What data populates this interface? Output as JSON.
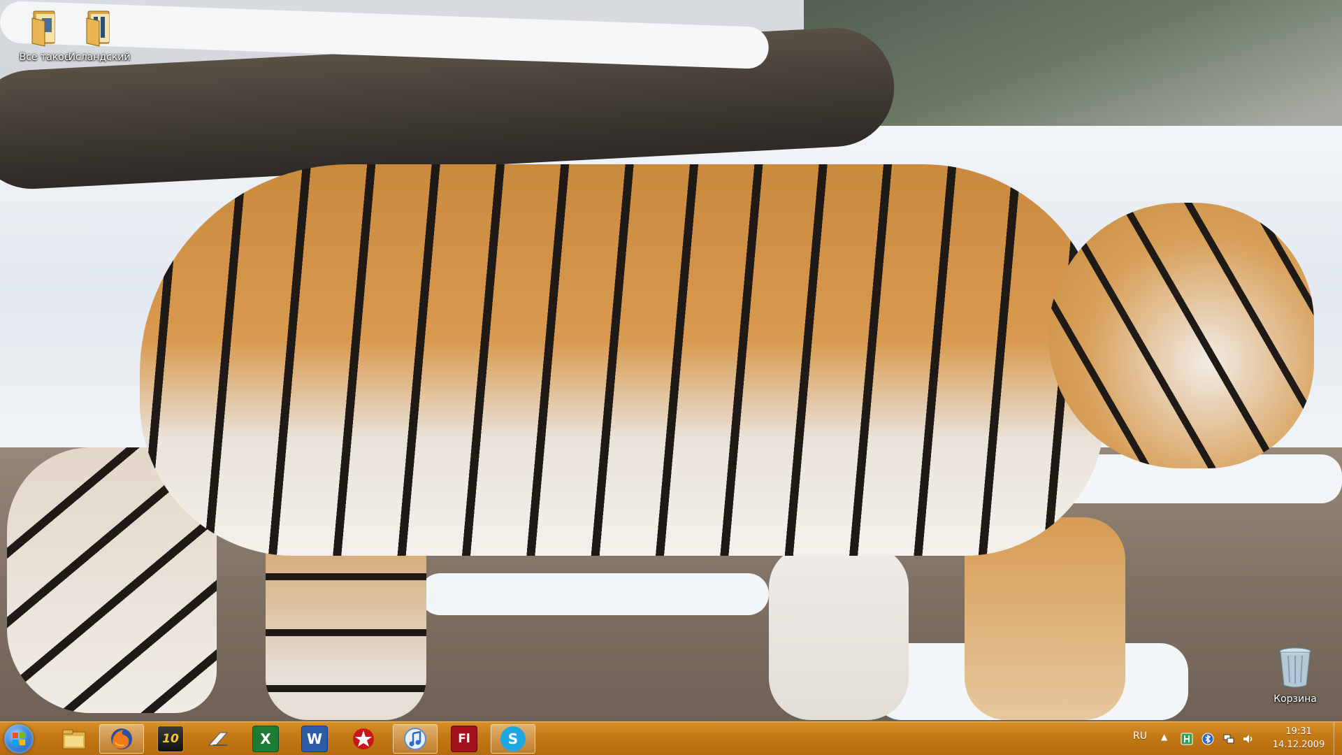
{
  "desktop": {
    "icons": [
      {
        "label": "Все такое",
        "icon": "folder-icon"
      },
      {
        "label": "Исландский",
        "icon": "folder-icon"
      }
    ],
    "recycle_bin": {
      "label": "Корзина",
      "icon": "recycle-bin-icon"
    }
  },
  "taskbar": {
    "start_icon": "windows-start-icon",
    "pinned": [
      {
        "name": "explorer",
        "icon": "folder-icon",
        "active": false
      },
      {
        "name": "firefox",
        "icon": "firefox-icon",
        "active": true
      },
      {
        "name": "game-10",
        "icon": "game-icon",
        "label": "10",
        "active": false
      },
      {
        "name": "ftp-client",
        "icon": "filezilla-icon",
        "active": false
      },
      {
        "name": "excel",
        "icon": "excel-icon",
        "active": false
      },
      {
        "name": "word",
        "icon": "word-icon",
        "active": false
      },
      {
        "name": "pokerstars",
        "icon": "star-icon",
        "active": false
      },
      {
        "name": "itunes",
        "icon": "itunes-icon",
        "active": true
      },
      {
        "name": "flash",
        "icon": "flash-icon",
        "label": "Fl",
        "active": false
      },
      {
        "name": "skype",
        "icon": "skype-icon",
        "label": "S",
        "active": false
      }
    ],
    "tray": {
      "language": "RU",
      "chevron": "▲",
      "clock_time": "19:31",
      "clock_date": "14.12.2009"
    }
  },
  "colors": {
    "taskbar": "#c57a17",
    "excel": "#1e7b34",
    "word": "#2a5caa",
    "flash": "#a3111a",
    "skype": "#1ea7e1"
  }
}
